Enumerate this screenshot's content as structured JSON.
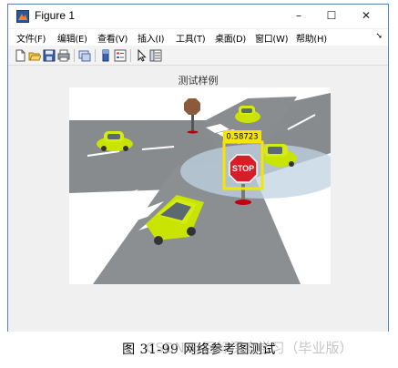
{
  "window": {
    "title": "Figure 1",
    "controls": {
      "minimize": "–",
      "maximize": "☐",
      "close": "✕"
    }
  },
  "menu": {
    "items": [
      "文件(F)",
      "编辑(E)",
      "查看(V)",
      "插入(I)",
      "工具(T)",
      "桌面(D)",
      "窗口(W)",
      "帮助(H)"
    ],
    "overflow": "➘"
  },
  "toolbar": {
    "icons": [
      "new-figure-icon",
      "open-file-icon",
      "save-icon",
      "print-icon",
      "link-plot-icon",
      "insert-colorbar-icon",
      "insert-legend-icon",
      "select-arrow-icon",
      "property-inspector-icon"
    ]
  },
  "plot": {
    "title": "测试样例",
    "detection": {
      "label": "0.58723",
      "color": "#f5e600"
    }
  },
  "caption": "图 31-99  网络参考图测试",
  "watermark": "CSDN @目标深度学习（毕业版）"
}
